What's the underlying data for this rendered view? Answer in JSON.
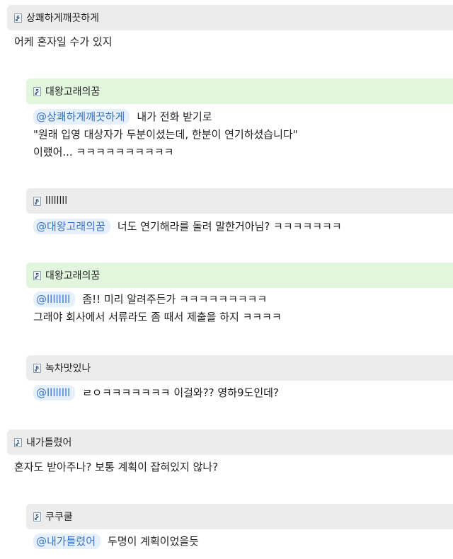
{
  "comments": [
    {
      "nickname": "상쾌하게깨끗하게",
      "level": "6",
      "header_style": "gray",
      "mention": "",
      "lines": [
        "어케 혼자일 수가 있지"
      ]
    },
    {
      "nickname": "대왕고래의꿈",
      "level": "5",
      "header_style": "green",
      "mention": "@상쾌하게깨끗하게",
      "lines": [
        "내가 전화 받기로",
        "\"원래 입영 대상자가 두분이셨는데, 한분이 연기하셨습니다\"",
        "이랬어... ㅋㅋㅋㅋㅋㅋㅋㅋㅋㅋ"
      ]
    },
    {
      "nickname": "llllllll",
      "level": "6",
      "header_style": "gray",
      "mention": "@대왕고래의꿈",
      "lines": [
        "너도 연기해라를 돌려 말한거아님? ㅋㅋㅋㅋㅋㅋㅋ"
      ]
    },
    {
      "nickname": "대왕고래의꿈",
      "level": "5",
      "header_style": "green",
      "mention": "@llllllll",
      "lines": [
        "좀!! 미리 알려주든가 ㅋㅋㅋㅋㅋㅋㅋㅋㅋ",
        "그래야 회사에서 서류라도 좀 때서 제출을 하지 ㅋㅋㅋㅋ"
      ]
    },
    {
      "nickname": "녹차맛있나",
      "level": "6",
      "header_style": "gray",
      "mention": "@llllllll",
      "lines": [
        "ㄹㅇㅋㅋㅋㅋㅋㅋㅋ 이걸와?? 영하9도인데?"
      ]
    },
    {
      "nickname": "내가틀렸어",
      "level": "1",
      "header_style": "gray",
      "mention": "",
      "lines": [
        "혼자도 받아주나? 보통 계획이 잡혀있지 않나?"
      ]
    },
    {
      "nickname": "쿠쿠쿨",
      "level": "5",
      "header_style": "gray",
      "mention": "@내가틀렸어",
      "lines": [
        "두명이 계획이었을듯"
      ]
    }
  ]
}
